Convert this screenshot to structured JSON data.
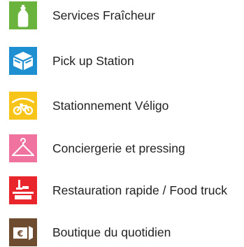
{
  "services": {
    "items": [
      {
        "label": "Services Fraîcheur",
        "icon": "bottle-icon",
        "color": "#6ab43e"
      },
      {
        "label": "Pick up Station",
        "icon": "package-box-icon",
        "color": "#1e8fd0"
      },
      {
        "label": "Stationnement Véligo",
        "icon": "bicycle-shelter-icon",
        "color": "#f7c51a"
      },
      {
        "label": "Conciergerie et pressing",
        "icon": "hanger-icon",
        "color": "#f0739f"
      },
      {
        "label": "Restauration rapide / Food truck",
        "icon": "food-tray-icon",
        "color": "#e8262b"
      },
      {
        "label": "Boutique du quotidien",
        "icon": "euro-shop-bag-icon",
        "color": "#6d4c30"
      }
    ]
  }
}
